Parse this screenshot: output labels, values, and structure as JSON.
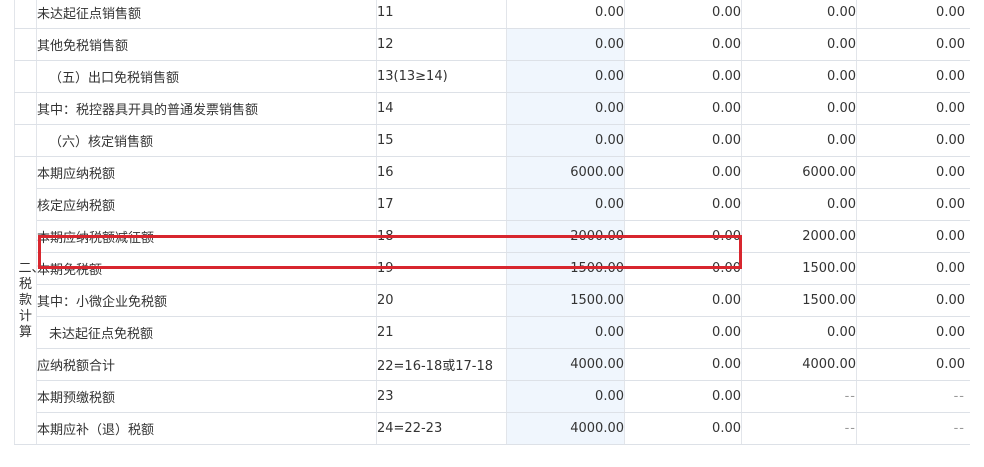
{
  "section_label": "二、税款计算",
  "rows": [
    {
      "name": "未达起征点销售额",
      "line": "11",
      "c1": "0.00",
      "c2": "0.00",
      "c3": "0.00",
      "c4": "0.00"
    },
    {
      "name": "其他免税销售额",
      "line": "12",
      "c1": "0.00",
      "c2": "0.00",
      "c3": "0.00",
      "c4": "0.00"
    },
    {
      "name": "（五）出口免税销售额",
      "line": "13(13≥14)",
      "c1": "0.00",
      "c2": "0.00",
      "c3": "0.00",
      "c4": "0.00"
    },
    {
      "name": "其中：税控器具开具的普通发票销售额",
      "line": "14",
      "c1": "0.00",
      "c2": "0.00",
      "c3": "0.00",
      "c4": "0.00"
    },
    {
      "name": "（六）核定销售额",
      "line": "15",
      "c1": "0.00",
      "c2": "0.00",
      "c3": "0.00",
      "c4": "0.00"
    },
    {
      "name": "本期应纳税额",
      "line": "16",
      "c1": "6000.00",
      "c2": "0.00",
      "c3": "6000.00",
      "c4": "0.00"
    },
    {
      "name": "核定应纳税额",
      "line": "17",
      "c1": "0.00",
      "c2": "0.00",
      "c3": "0.00",
      "c4": "0.00"
    },
    {
      "name": "本期应纳税额减征额",
      "line": "18",
      "c1": "2000.00",
      "c2": "0.00",
      "c3": "2000.00",
      "c4": "0.00"
    },
    {
      "name": "本期免税额",
      "line": "19",
      "c1": "1500.00",
      "c2": "0.00",
      "c3": "1500.00",
      "c4": "0.00"
    },
    {
      "name": "其中：小微企业免税额",
      "line": "20",
      "c1": "1500.00",
      "c2": "0.00",
      "c3": "1500.00",
      "c4": "0.00"
    },
    {
      "name": "未达起征点免税额",
      "line": "21",
      "c1": "0.00",
      "c2": "0.00",
      "c3": "0.00",
      "c4": "0.00"
    },
    {
      "name": "应纳税额合计",
      "line": "22=16-18或17-18",
      "c1": "4000.00",
      "c2": "0.00",
      "c3": "4000.00",
      "c4": "0.00"
    },
    {
      "name": "本期预缴税额",
      "line": "23",
      "c1": "0.00",
      "c2": "0.00",
      "c3": "--",
      "c4": "--"
    },
    {
      "name": "本期应补（退）税额",
      "line": "24=22-23",
      "c1": "4000.00",
      "c2": "0.00",
      "c3": "--",
      "c4": "--"
    }
  ],
  "colors": {
    "highlight": "#d8262e",
    "editable_cell": "#f0f6fd",
    "grid": "#dde1e7"
  }
}
